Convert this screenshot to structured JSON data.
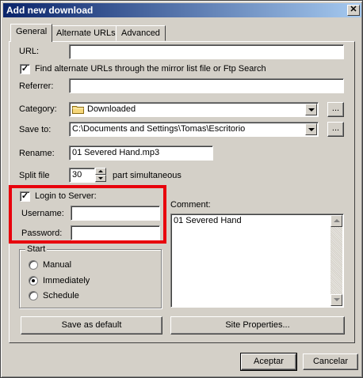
{
  "window": {
    "title": "Add new download",
    "close_glyph": "✕"
  },
  "tabs": [
    {
      "label": "General",
      "active": true
    },
    {
      "label": "Alternate URLs",
      "active": false
    },
    {
      "label": "Advanced",
      "active": false
    }
  ],
  "general": {
    "url_label": "URL:",
    "url_value": "",
    "find_alt_label": "Find alternate URLs through the mirror list file or Ftp Search",
    "find_alt_checked": true,
    "referrer_label": "Referrer:",
    "referrer_value": "",
    "category_label": "Category:",
    "category_value": "Downloaded",
    "category_icon": "folder-icon",
    "category_more": "...",
    "save_to_label": "Save to:",
    "save_to_value": "C:\\Documents and Settings\\Tomas\\Escritorio",
    "save_to_more": "...",
    "rename_label": "Rename:",
    "rename_value": "01 Severed Hand.mp3",
    "split_label": "Split file",
    "split_value": "30",
    "split_suffix": "part simultaneous",
    "login_label": "Login to Server:",
    "login_checked": true,
    "username_label": "Username:",
    "username_value": "",
    "password_label": "Password:",
    "password_value": "",
    "comment_label": "Comment:",
    "comment_value": "01 Severed Hand",
    "start_group_label": "Start",
    "start_options": [
      {
        "label": "Manual",
        "selected": false
      },
      {
        "label": "Immediately",
        "selected": true
      },
      {
        "label": "Schedule",
        "selected": false
      }
    ],
    "save_default_label": "Save as default",
    "site_properties_label": "Site Properties..."
  },
  "footer": {
    "ok_label": "Aceptar",
    "cancel_label": "Cancelar"
  },
  "colors": {
    "title_start": "#0a246a",
    "title_end": "#a6caf0",
    "highlight_border": "#e8000c",
    "face": "#d4d0c8"
  }
}
